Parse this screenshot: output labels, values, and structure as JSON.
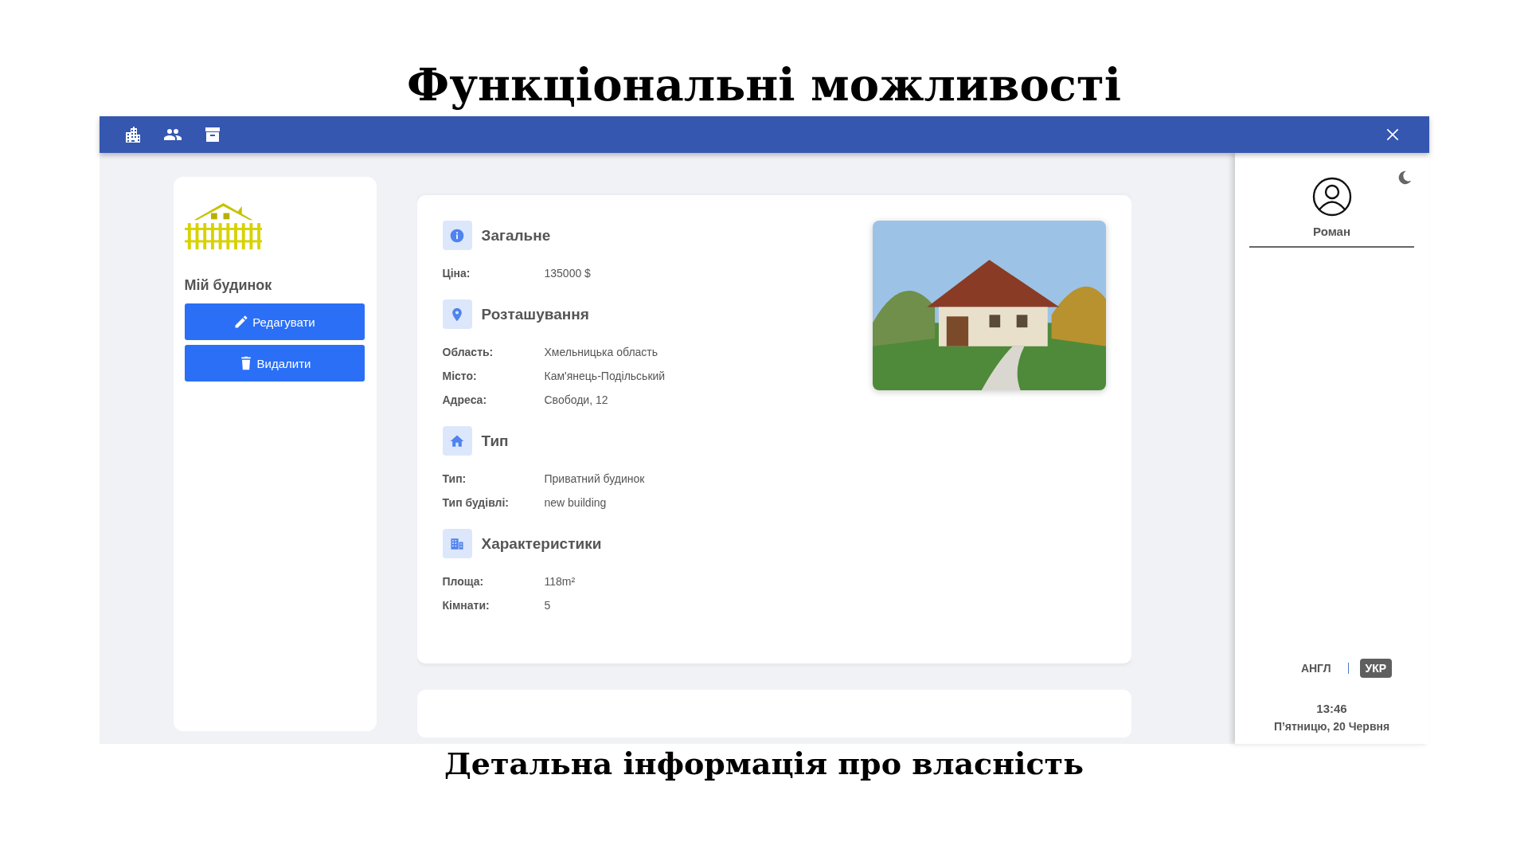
{
  "slide": {
    "title": "Функціональні можливості",
    "caption": "Детальна інформація про власність"
  },
  "property": {
    "name": "Мій будинок",
    "actions": [
      {
        "kind": "edit",
        "label": "Редагувати"
      },
      {
        "kind": "delete",
        "label": "Видалити"
      }
    ]
  },
  "sections": [
    {
      "kind": "info",
      "title": "Загальне",
      "rows": [
        {
          "label": "Ціна:",
          "value": "135000 $"
        }
      ]
    },
    {
      "kind": "location",
      "title": "Розташування",
      "rows": [
        {
          "label": "Область:",
          "value": "Хмельницька область"
        },
        {
          "label": "Місто:",
          "value": "Кам'янець-Подільський"
        },
        {
          "label": "Адреса:",
          "value": "Свободи, 12"
        }
      ]
    },
    {
      "kind": "type",
      "title": "Тип",
      "rows": [
        {
          "label": "Тип:",
          "value": "Приватний будинок"
        },
        {
          "label": "Тип будівлі:",
          "value": "new building"
        }
      ]
    },
    {
      "kind": "features",
      "title": "Характеристики",
      "rows": [
        {
          "label": "Площа:",
          "value": "118m²"
        },
        {
          "label": "Кімнати:",
          "value": "5"
        }
      ]
    }
  ],
  "user": {
    "name": "Роман"
  },
  "languages": [
    {
      "label": "АНГЛ",
      "selected": false
    },
    {
      "label": "УКР",
      "selected": true
    }
  ],
  "clock": {
    "time": "13:46",
    "date": "П’ятницю, 20 Червня"
  }
}
